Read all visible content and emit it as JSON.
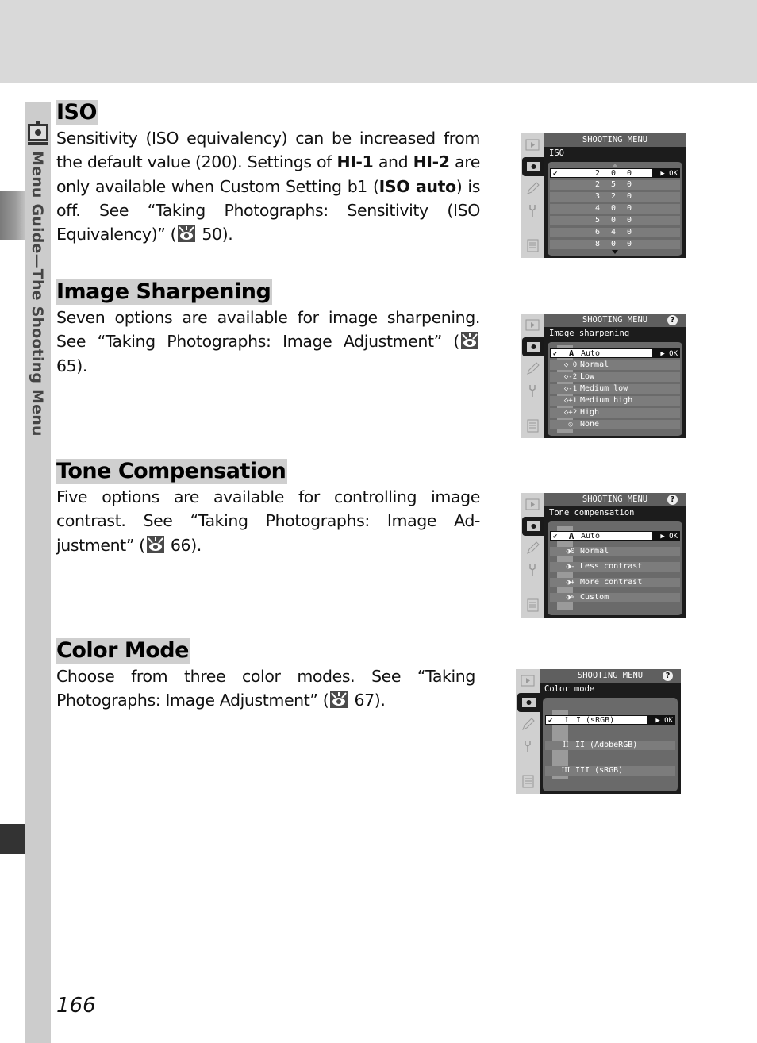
{
  "side_tab": {
    "label": "Menu Guide—The Shooting Menu",
    "icon": "camera-menu-icon"
  },
  "sections": [
    {
      "title": "ISO",
      "body_parts": [
        "Sensitivity (ISO equivalency) can be increased from the default value (200).  Settings of ",
        "HI-1",
        " and ",
        "HI-2",
        " are only available when Custom Setting b1 (",
        "ISO auto",
        ") is off.  See “Taking Photographs: Sensitivity (ISO Equivalency)” (",
        "50",
        ")."
      ],
      "ref_icon": "reference-eye-icon",
      "ref_page": "50"
    },
    {
      "title": "Image Sharpening",
      "body_before": "Seven options are available for image sharpening. See “Taking Photographs: Image Adjustment” (",
      "ref_page": "65",
      "body_after": ").",
      "ref_icon": "reference-eye-icon"
    },
    {
      "title": "Tone Compensation",
      "body_before": "Five options are available for controlling image contrast.  See “Taking Photographs: Image Ad-justment” (",
      "ref_page": "66",
      "body_after": ").",
      "ref_icon": "reference-eye-icon"
    },
    {
      "title": "Color Mode",
      "body_before": "Choose from three color modes.  See “Taking Photographs: Image Adjustment” (",
      "ref_page": "67",
      "body_after": ").",
      "ref_icon": "reference-eye-icon"
    }
  ],
  "screens": {
    "iso": {
      "header": "SHOOTING MENU",
      "subtitle": "ISO",
      "ok_label": "▶ OK",
      "check": "✔",
      "options": [
        "2 0 0",
        "2 5 0",
        "3 2 0",
        "4 0 0",
        "5 0 0",
        "6 4 0",
        "8 0 0"
      ],
      "selected": 0
    },
    "sharpening": {
      "header": "SHOOTING MENU",
      "help": "?",
      "subtitle": "Image sharpening",
      "ok_label": "▶ OK",
      "check": "✔",
      "options": [
        {
          "symbol": "A",
          "label": "Auto"
        },
        {
          "symbol": "◇ 0",
          "label": "Normal"
        },
        {
          "symbol": "◇-2",
          "label": "Low"
        },
        {
          "symbol": "◇-1",
          "label": "Medium low"
        },
        {
          "symbol": "◇+1",
          "label": "Medium high"
        },
        {
          "symbol": "◇+2",
          "label": "High"
        },
        {
          "symbol": "⦸",
          "label": "None"
        }
      ],
      "selected": 0
    },
    "tone": {
      "header": "SHOOTING MENU",
      "help": "?",
      "subtitle": "Tone compensation",
      "ok_label": "▶ OK",
      "check": "✔",
      "options": [
        {
          "symbol": "A",
          "label": "Auto"
        },
        {
          "symbol": "◑0",
          "label": "Normal"
        },
        {
          "symbol": "◑-",
          "label": "Less contrast"
        },
        {
          "symbol": "◑+",
          "label": "More contrast"
        },
        {
          "symbol": "◑✎",
          "label": "Custom"
        }
      ],
      "selected": 0
    },
    "color": {
      "header": "SHOOTING MENU",
      "help": "?",
      "subtitle": "Color mode",
      "ok_label": "▶ OK",
      "check": "✔",
      "options": [
        {
          "symbol": "I",
          "label": "I (sRGB)"
        },
        {
          "symbol": "II",
          "label": "II (AdobeRGB)"
        },
        {
          "symbol": "III",
          "label": "III (sRGB)"
        }
      ],
      "selected": 0
    }
  },
  "page_number": "166"
}
